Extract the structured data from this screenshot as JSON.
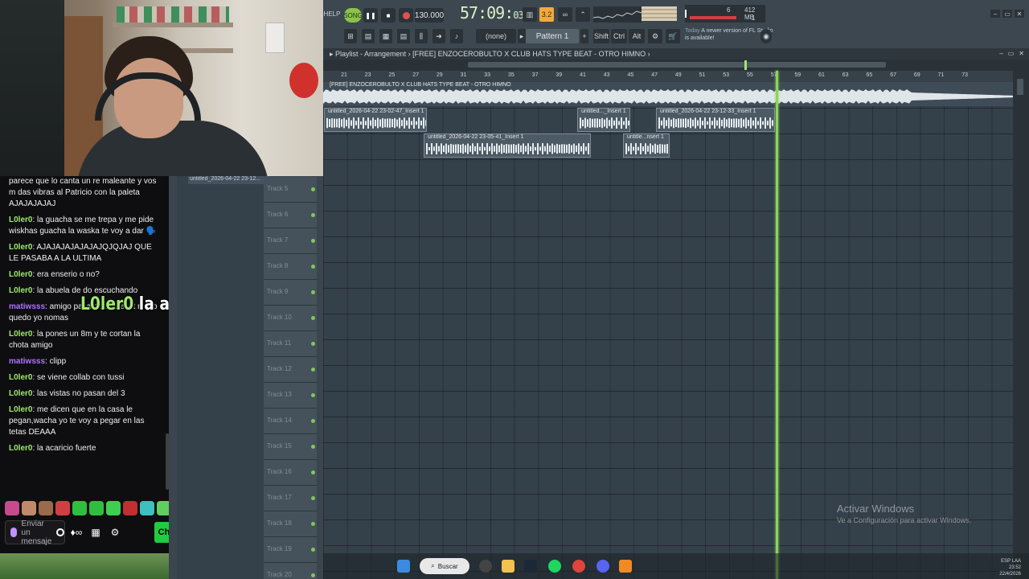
{
  "chat": {
    "messages": [
      {
        "user": "",
        "text": "parece que lo canta un re maleante y vos m das vibras al Patricio con la paleta AJAJAJAJAJ",
        "color": "c1"
      },
      {
        "user": "L0ler0",
        "text": "la guacha se me trepa y me pide wiskhas guacha la waska te voy a dar 🗣️",
        "color": "c1"
      },
      {
        "user": "L0ler0",
        "text": "AJAJAJAJAJAJAJQJQJAJ QUE LE PASABA A LA ULTIMA",
        "color": "c1"
      },
      {
        "user": "L0ler0",
        "text": "era enserio o no?",
        "color": "c1"
      },
      {
        "user": "L0ler0",
        "text": "la abuela de do escuchando",
        "color": "c1"
      },
      {
        "user": "matiwsss",
        "text": "amigo pasame el preset me lo quedo yo nomas",
        "color": "c2"
      },
      {
        "user": "L0ler0",
        "text": "la pones un 8m y te cortan la chota amigo",
        "color": "c1"
      },
      {
        "user": "matiwsss",
        "text": "clipp",
        "color": "c2"
      },
      {
        "user": "L0ler0",
        "text": "se viene collab con tussi",
        "color": "c1"
      },
      {
        "user": "L0ler0",
        "text": "las vistas no pasan del 3",
        "color": "c1"
      },
      {
        "user": "L0ler0",
        "text": "me dicen que en la casa le pegan,wacha yo te voy a pegar en las tetas DEAAA",
        "color": "c1"
      },
      {
        "user": "L0ler0",
        "text": "la acaricio fuerte",
        "color": "c1"
      }
    ],
    "input_placeholder": "Enviar un mensaje",
    "chat_button": "Ch"
  },
  "caption": {
    "user": "L0ler0",
    "text": "la acaricio fuerte"
  },
  "fl": {
    "help": "HELP",
    "song": "SONG",
    "tempo": "130.000",
    "time_main": "57:09",
    "time_sub": "03",
    "step": "3.2",
    "cpu_val1": "6",
    "cpu_mem": "412 MB",
    "cpu_val3": "1",
    "snap": "(none)",
    "pattern": "Pattern 1",
    "shift": "Shift",
    "ctrl": "Ctrl",
    "alt": "Alt",
    "news_label": "Today",
    "news_text": "A newer version of FL Studio is available!"
  },
  "playlist": {
    "header": "Playlist - Arrangement",
    "project": "[FREE] ENZOCEROBULTO X CLUB HATS TYPE BEAT - OTRO HIMNO",
    "audio_clip": "[FREE] ENZOCEROBULTO X CLUB HATS TYPE BEAT - OTRO HIMNO",
    "ruler": [
      "21",
      "23",
      "25",
      "27",
      "29",
      "31",
      "33",
      "35",
      "37",
      "39",
      "41",
      "43",
      "45",
      "47",
      "49",
      "51",
      "53",
      "55",
      "57",
      "59",
      "61",
      "63",
      "65",
      "67",
      "69",
      "71",
      "73"
    ],
    "clips": [
      {
        "label": "untitled_2026-04-22 23-02-47_Insert 1"
      },
      {
        "label": "untitled..._Insert 1"
      },
      {
        "label": "untitled_2026-04-22 23-12-33_Insert 1"
      },
      {
        "label": "untitled_2026-04-22 23-05-41_Insert 1"
      },
      {
        "label": "untitle...nsert 1"
      }
    ],
    "browser_clip": "untitled_2026-04-22 23-12...",
    "tracks": [
      "Track 5",
      "Track 6",
      "Track 7",
      "Track 8",
      "Track 9",
      "Track 10",
      "Track 11",
      "Track 12",
      "Track 13",
      "Track 14",
      "Track 15",
      "Track 16",
      "Track 17",
      "Track 18",
      "Track 19",
      "Track 20"
    ]
  },
  "windows": {
    "activate_title": "Activar Windows",
    "activate_sub": "Ve a Configuración para activar Windows.",
    "search": "Buscar",
    "tray_lang": "ESP LAA",
    "tray_time": "23:52",
    "tray_date": "22/4/2026"
  }
}
